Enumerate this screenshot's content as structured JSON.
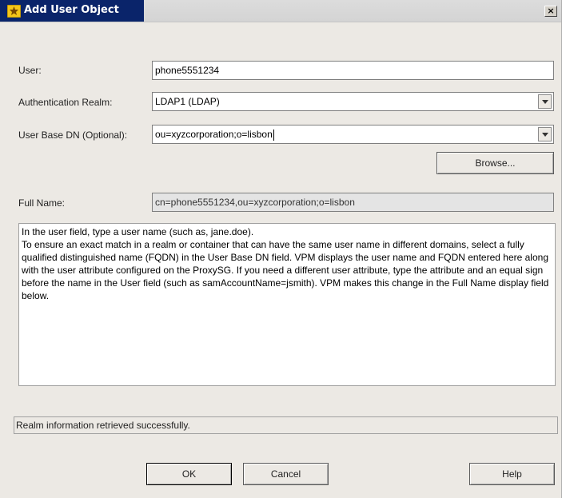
{
  "window": {
    "title": "Add User Object",
    "close_label": "×"
  },
  "form": {
    "user_label": "User:",
    "user_value": "phone5551234",
    "realm_label": "Authentication Realm:",
    "realm_value": "LDAP1 (LDAP)",
    "base_dn_label": "User Base DN (Optional):",
    "base_dn_value": "ou=xyzcorporation;o=lisbon",
    "browse_label": "Browse...",
    "full_name_label": "Full Name:",
    "full_name_value": "cn=phone5551234,ou=xyzcorporation;o=lisbon"
  },
  "help": {
    "text": "In the user field, type a user name (such as, jane.doe).\nTo ensure an exact match in a realm or container that can have the same user name in different domains, select a fully qualified distinguished name (FQDN) in the User Base DN field. VPM displays the user name and FQDN entered here along with the user attribute configured on the ProxySG. If you need a different user attribute, type the attribute and an equal sign before the name in the User field (such as samAccountName=jsmith). VPM makes this change in the Full Name display field below."
  },
  "status": {
    "message": "Realm information retrieved successfully."
  },
  "buttons": {
    "ok": "OK",
    "cancel": "Cancel",
    "help": "Help"
  },
  "colors": {
    "title_bar": "#0a246a",
    "dialog_bg": "#ece9e4",
    "readonly_field": "#e4e4e4"
  }
}
